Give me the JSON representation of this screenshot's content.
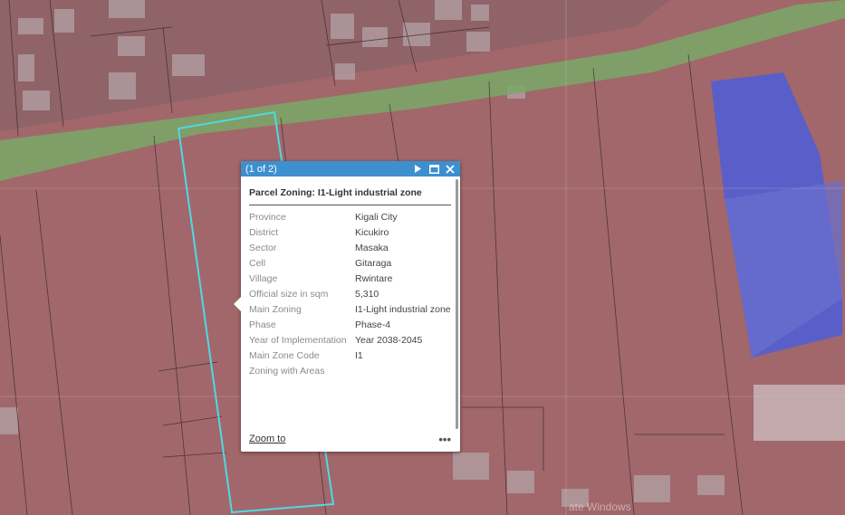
{
  "popup": {
    "count": "(1 of 2)",
    "title": "Parcel Zoning: I1-Light industrial zone",
    "attributes": [
      {
        "label": "Province",
        "value": "Kigali City"
      },
      {
        "label": "District",
        "value": "Kicukiro"
      },
      {
        "label": "Sector",
        "value": "Masaka"
      },
      {
        "label": "Cell",
        "value": "Gitaraga"
      },
      {
        "label": "Village",
        "value": "Rwintare"
      },
      {
        "label": "Official size in sqm",
        "value": "5,310"
      },
      {
        "label": "Main Zoning",
        "value": "I1-Light industrial zone"
      },
      {
        "label": "Phase",
        "value": "Phase-4"
      },
      {
        "label": "Year of Implementation",
        "value": "Year 2038-2045"
      },
      {
        "label": "Main Zone Code",
        "value": "I1"
      },
      {
        "label": "Zoning with Areas",
        "value": ""
      }
    ],
    "zoom_label": "Zoom to",
    "more_label": "•••",
    "icons": {
      "next": "play-icon",
      "maximize": "maximize-icon",
      "close": "close-icon"
    }
  },
  "watermark": "ate Windows",
  "colors": {
    "header": "#3d8fd0",
    "selected_parcel_outline": "#4fd8e4",
    "road_zone": "#7fae6c",
    "industrial_zone": "#a3676c",
    "roof": "#5a5ec8"
  }
}
